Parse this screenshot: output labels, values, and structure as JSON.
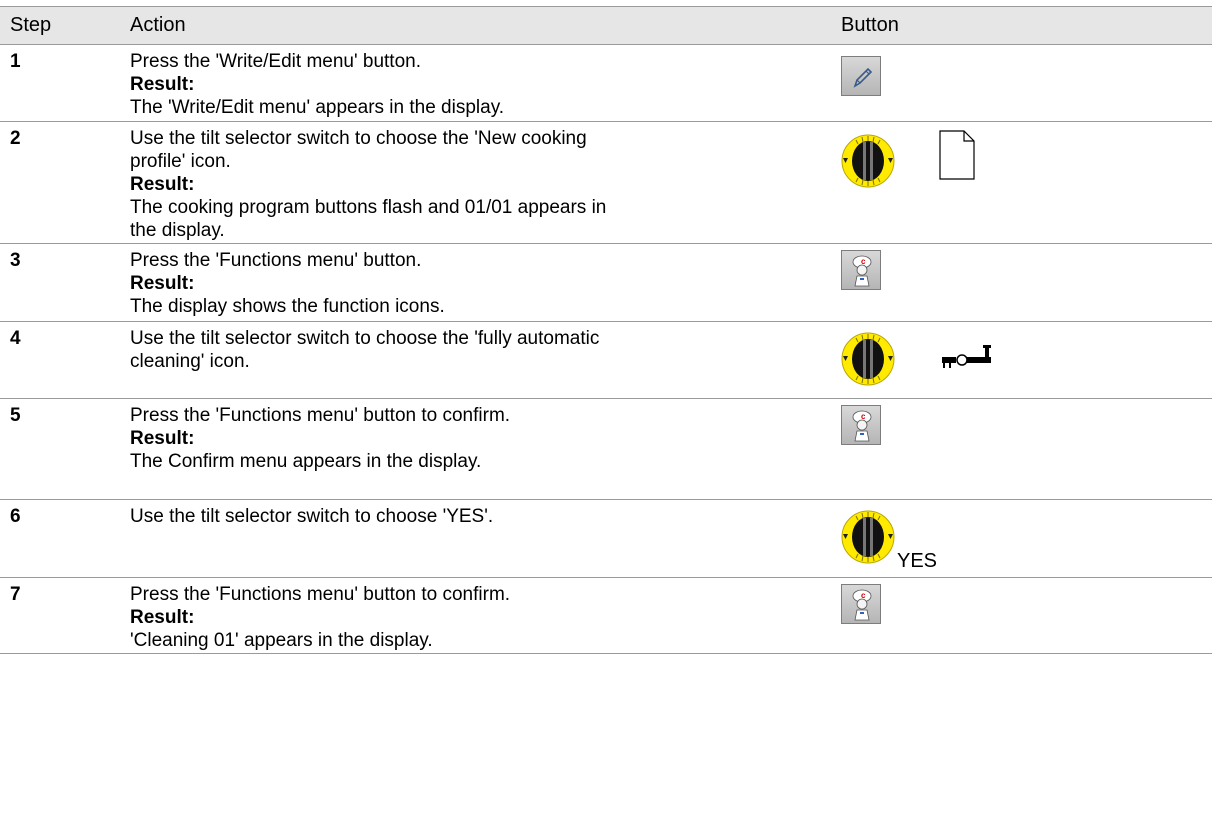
{
  "table": {
    "headers": {
      "step": "Step",
      "action": "Action",
      "button": "Button"
    },
    "rows": [
      {
        "step": "1",
        "action": "Press the 'Write/Edit menu' button.",
        "result_label": "Result:",
        "result": "The 'Write/Edit menu' appears in the display.",
        "button": "pencil-button"
      },
      {
        "step": "2",
        "action_l1": "Use the tilt selector switch to choose the 'New cooking",
        "action_l2": "profile' icon.",
        "result_label": "Result:",
        "result_l1": "The cooking program buttons flash and 01/01 appears in",
        "result_l2": "the display.",
        "button": "tilt-selector + document-icon"
      },
      {
        "step": "3",
        "action": "Press the 'Functions menu' button.",
        "result_label": "Result:",
        "result": "The display shows the function icons.",
        "button": "chef-button"
      },
      {
        "step": "4",
        "action_l1": "Use the tilt selector switch to choose the 'fully automatic",
        "action_l2": "cleaning' icon.",
        "button": "tilt-selector + cleaning-icon"
      },
      {
        "step": "5",
        "action": "Press the 'Functions menu' button to confirm.",
        "result_label": "Result:",
        "result": "The Confirm menu appears in the display.",
        "button": "chef-button"
      },
      {
        "step": "6",
        "action": "Use the tilt selector switch to choose 'YES'.",
        "button_text": "YES",
        "button": "tilt-selector"
      },
      {
        "step": "7",
        "action": "Press the 'Functions menu' button to confirm.",
        "result_label": "Result:",
        "result": "'Cleaning 01' appears in the display.",
        "button": "chef-button"
      }
    ]
  },
  "colors": {
    "header_bg": "#e6e6e6",
    "knob_yellow": "#ffea00",
    "rule": "#9a9a9a"
  }
}
